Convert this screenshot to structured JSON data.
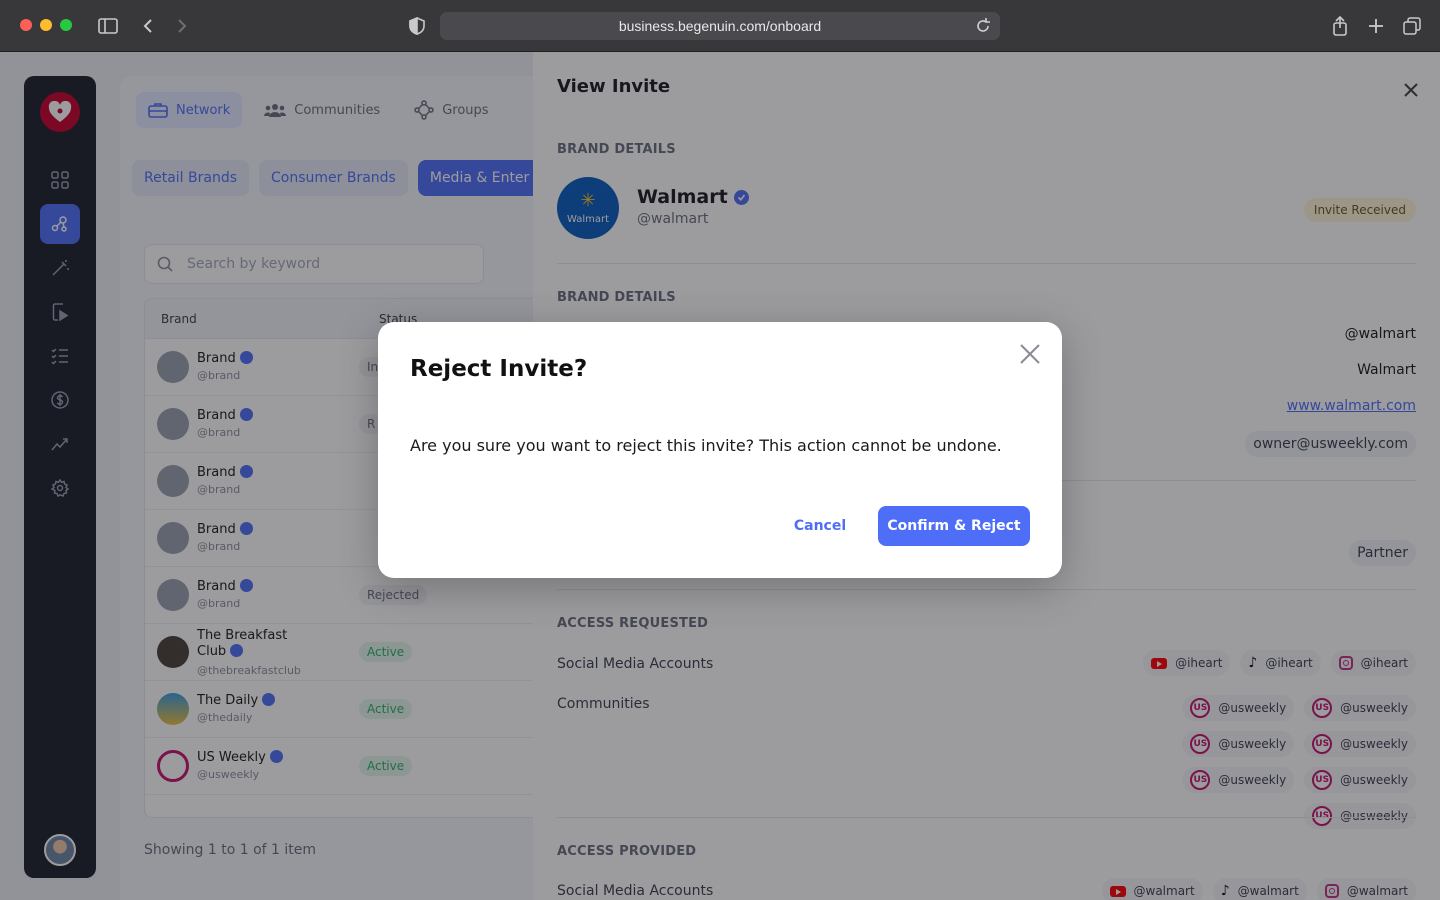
{
  "browser": {
    "url": "business.begenuin.com/onboard"
  },
  "nav": {
    "tabs": [
      {
        "label": "Network",
        "icon": "briefcase-icon"
      },
      {
        "label": "Communities",
        "icon": "people-icon"
      },
      {
        "label": "Groups",
        "icon": "groups-icon"
      }
    ],
    "filters": [
      "Retail Brands",
      "Consumer Brands",
      "Media & Enter"
    ]
  },
  "search": {
    "placeholder": "Search by keyword"
  },
  "table": {
    "headers": [
      "Brand",
      "Status"
    ],
    "rows": [
      {
        "name": "Brand",
        "handle": "@brand",
        "status": "Invit"
      },
      {
        "name": "Brand",
        "handle": "@brand",
        "status": "R"
      },
      {
        "name": "Brand",
        "handle": "@brand",
        "status": ""
      },
      {
        "name": "Brand",
        "handle": "@brand",
        "status": ""
      },
      {
        "name": "Brand",
        "handle": "@brand",
        "status": "Rejected"
      },
      {
        "name": "The Breakfast Club",
        "handle": "@thebreakfastclub",
        "status": "Active"
      },
      {
        "name": "The Daily",
        "handle": "@thedaily",
        "status": "Active"
      },
      {
        "name": "US Weekly",
        "handle": "@usweekly",
        "status": "Active"
      }
    ],
    "footer": "Showing 1 to 1 of 1 item"
  },
  "drawer": {
    "title": "View Invite",
    "section_brand_details": "BRAND DETAILS",
    "brand": {
      "name": "Walmart",
      "handle": "@walmart",
      "logo_text": "Walmart",
      "badge": "Invite Received"
    },
    "section_brand_details_2": "BRAND DETAILS",
    "details": {
      "handle": "@walmart",
      "name": "Walmart",
      "website": "www.walmart.com",
      "email": "owner@usweekly.com",
      "role": "Partner"
    },
    "section_access_requested": "ACCESS REQUESTED",
    "access_requested": {
      "social_label": "Social Media Accounts",
      "social": [
        {
          "platform": "youtube-icon",
          "handle": "@iheart"
        },
        {
          "platform": "tiktok-icon",
          "handle": "@iheart"
        },
        {
          "platform": "instagram-icon",
          "handle": "@iheart"
        }
      ],
      "communities_label": "Communities",
      "communities": [
        "@usweekly",
        "@usweekly",
        "@usweekly",
        "@usweekly",
        "@usweekly",
        "@usweekly",
        "@usweekly"
      ]
    },
    "section_access_provided": "ACCESS PROVIDED",
    "access_provided": {
      "social_label": "Social Media Accounts",
      "social": [
        {
          "platform": "youtube-icon",
          "handle": "@walmart"
        },
        {
          "platform": "tiktok-icon",
          "handle": "@walmart"
        },
        {
          "platform": "instagram-icon",
          "handle": "@walmart"
        }
      ]
    }
  },
  "modal": {
    "title": "Reject Invite?",
    "body": "Are you sure you want to reject this invite? This action cannot be undone.",
    "cancel_label": "Cancel",
    "confirm_label": "Confirm & Reject"
  },
  "colors": {
    "accent": "#4f6ef7",
    "rail": "#1c1f2b",
    "walmart_blue": "#0a5ebd",
    "badge_bg": "#fdf4d8"
  }
}
